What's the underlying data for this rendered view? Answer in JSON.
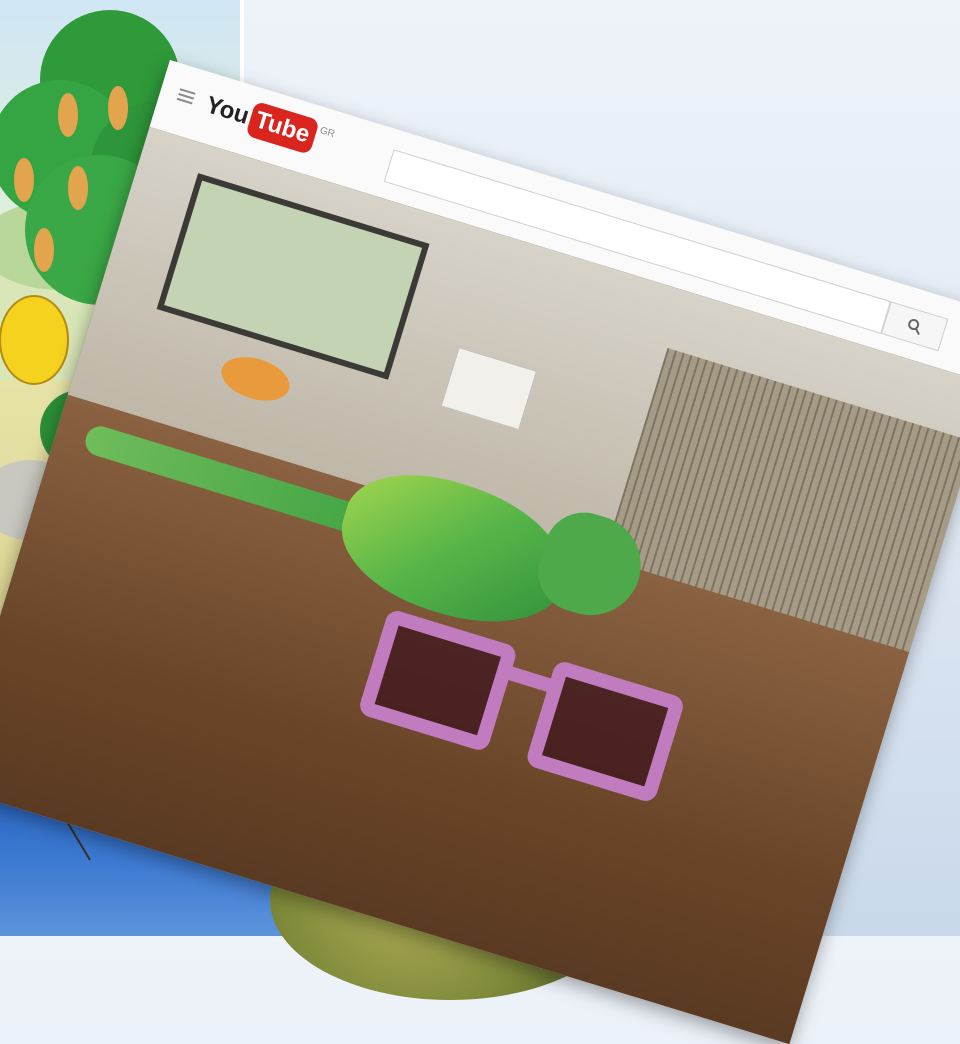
{
  "youtube": {
    "logo_you": "You",
    "logo_tube": "Tube",
    "logo_country": "GR",
    "search": {
      "placeholder": ""
    },
    "icons": {
      "menu": "hamburger-menu-icon",
      "search": "search-icon"
    }
  },
  "colors": {
    "youtube_red": "#d9251d",
    "sunglasses": "#c07cbf",
    "chameleon_green": "#56b548"
  }
}
